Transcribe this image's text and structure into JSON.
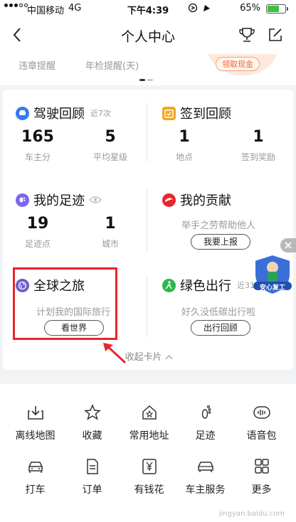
{
  "status_bar": {
    "carrier": "中国移动",
    "network": "4G",
    "time": "下午4:39",
    "battery": "65%",
    "battery_level": 0.65
  },
  "nav": {
    "title": "个人中心"
  },
  "top_strip": {
    "item1": "违章提醒",
    "item2": "年检提醒(天)",
    "coin_button": "领取现金"
  },
  "drive_review": {
    "title": "驾驶回顾",
    "subtitle": "近7次",
    "stat1_value": "165",
    "stat1_label": "车主分",
    "stat2_value": "5",
    "stat2_label": "平均星级"
  },
  "checkin_review": {
    "title": "签到回顾",
    "stat1_value": "1",
    "stat1_label": "地点",
    "stat2_value": "1",
    "stat2_label": "签到奖励"
  },
  "footprint": {
    "title": "我的足迹",
    "stat1_value": "19",
    "stat1_label": "足迹点",
    "stat2_value": "1",
    "stat2_label": "城市"
  },
  "contribution": {
    "title": "我的贡献",
    "desc": "举手之劳帮助他人",
    "button": "我要上报"
  },
  "global_trip": {
    "title": "全球之旅",
    "desc": "计划我的国际旅行",
    "button": "看世界"
  },
  "green_trip": {
    "title": "绿色出行",
    "subtitle": "近31天",
    "desc": "好久没低碳出行啦",
    "button": "出行回顾"
  },
  "collapse_label": "收起卡片",
  "float_badge": {
    "text": "安心复工"
  },
  "grid": {
    "row1": [
      {
        "label": "离线地图",
        "icon": "offline-map-icon"
      },
      {
        "label": "收藏",
        "icon": "star-icon"
      },
      {
        "label": "常用地址",
        "icon": "home-star-icon"
      },
      {
        "label": "足迹",
        "icon": "footprint-icon"
      },
      {
        "label": "语音包",
        "icon": "voice-pack-icon"
      }
    ],
    "row2": [
      {
        "label": "打车",
        "icon": "taxi-icon"
      },
      {
        "label": "订单",
        "icon": "order-icon"
      },
      {
        "label": "有钱花",
        "icon": "money-icon"
      },
      {
        "label": "车主服务",
        "icon": "car-service-icon"
      },
      {
        "label": "更多",
        "icon": "more-grid-icon"
      }
    ]
  },
  "watermark": "jingyan.baidu.com",
  "colors": {
    "accent_blue": "#3478f6",
    "orange": "#f5a623",
    "purple": "#7b68ee",
    "red": "#e8262c",
    "green": "#2db84d"
  }
}
